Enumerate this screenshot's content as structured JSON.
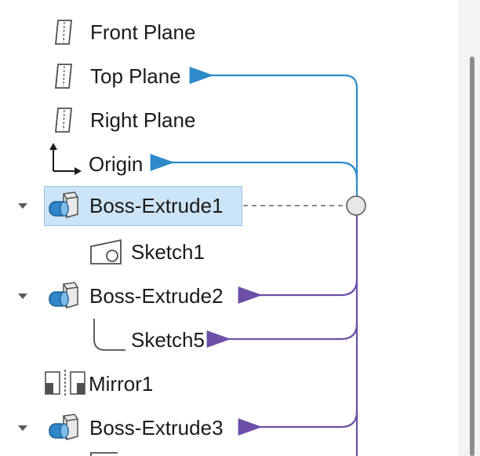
{
  "tree": {
    "items": [
      {
        "label": "Front Plane",
        "icon": "plane-icon"
      },
      {
        "label": "Top Plane",
        "icon": "plane-icon"
      },
      {
        "label": "Right Plane",
        "icon": "plane-icon"
      },
      {
        "label": "Origin",
        "icon": "origin-axes-icon"
      },
      {
        "label": "Boss-Extrude1",
        "icon": "extrude-feature-icon",
        "expanded": true,
        "selected": true
      },
      {
        "label": "Sketch1",
        "icon": "sketch-icon"
      },
      {
        "label": "Boss-Extrude2",
        "icon": "extrude-feature-icon",
        "expanded": true
      },
      {
        "label": "Sketch5",
        "icon": "sketch-profile-icon"
      },
      {
        "label": "Mirror1",
        "icon": "mirror-feature-icon"
      },
      {
        "label": "Boss-Extrude3",
        "icon": "extrude-feature-icon",
        "expanded": true
      }
    ]
  },
  "colors": {
    "parent_arrow": "#2f8ac9",
    "child_arrow": "#6b4fa8",
    "selection": "#cce4f7",
    "dashed_link": "#8a8a8a"
  }
}
